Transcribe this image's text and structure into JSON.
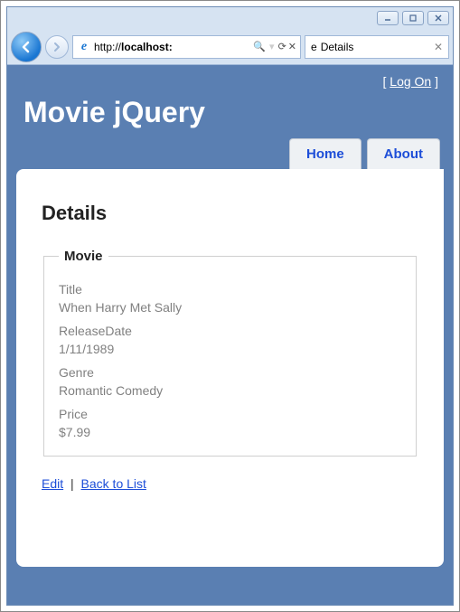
{
  "browser": {
    "url_prefix": "http://",
    "url_host": "localhost:",
    "search_icon": "🔍",
    "tab_title": "Details"
  },
  "header": {
    "logon_label": "Log On",
    "site_title": "Movie jQuery"
  },
  "nav": {
    "home": "Home",
    "about": "About"
  },
  "page": {
    "heading": "Details",
    "legend": "Movie",
    "fields": {
      "title_label": "Title",
      "title_value": "When Harry Met Sally",
      "release_label": "ReleaseDate",
      "release_value": "1/11/1989",
      "genre_label": "Genre",
      "genre_value": "Romantic Comedy",
      "price_label": "Price",
      "price_value": "$7.99"
    },
    "actions": {
      "edit": "Edit",
      "back": "Back to List"
    }
  }
}
